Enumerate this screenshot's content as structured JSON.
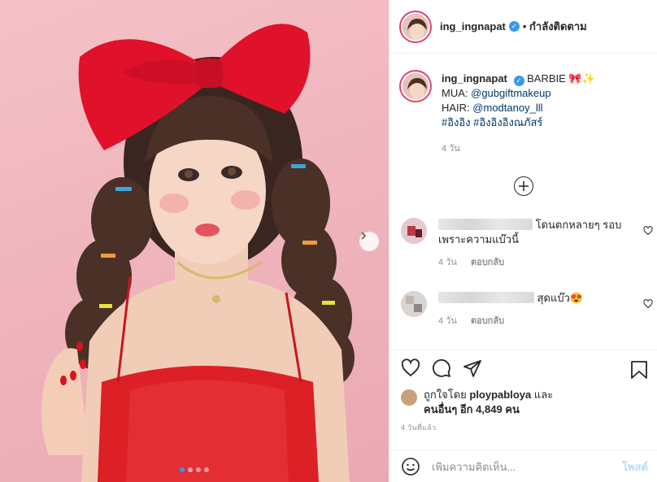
{
  "post": {
    "username": "ing_ingnapat",
    "follow_label": "• กำลังติดตาม",
    "caption": {
      "username": "ing_ingnapat",
      "title": "BARBIE 🎀✨",
      "mua_label": "MUA:",
      "mua_handle": "@gubgiftmakeup",
      "hair_label": "HAIR:",
      "hair_handle": "@modtanoy_lll",
      "hashtags": "#อิงอิง #อิงอิงอิงณภัสร์",
      "time": "4 วัน"
    },
    "load_more_icon": "plus-circle-icon",
    "comments": [
      {
        "text": "โดนตกหลายๆ รอบเพราะความแบ๊วนี้",
        "time": "4 วัน",
        "reply_label": "ตอบกลับ"
      },
      {
        "text": "สุดแบ๊ว😍",
        "time": "4 วัน",
        "reply_label": "ตอบกลับ"
      }
    ],
    "likes": {
      "prefix": "ถูกใจโดย",
      "liker": "ploypabloya",
      "and": "และ",
      "others": "คนอื่นๆ อีก 4,849 คน"
    },
    "timestamp": "4 วันที่แล้ว",
    "add_comment_placeholder": "เพิ่มความคิดเห็น...",
    "post_button": "โพสต์"
  },
  "carousel": {
    "slides": 4,
    "active": 1
  },
  "colors": {
    "accent": "#3897f0",
    "ring": "#e13f6c",
    "photo_bg": "#f2b9c0",
    "bow_red": "#e0112a"
  }
}
